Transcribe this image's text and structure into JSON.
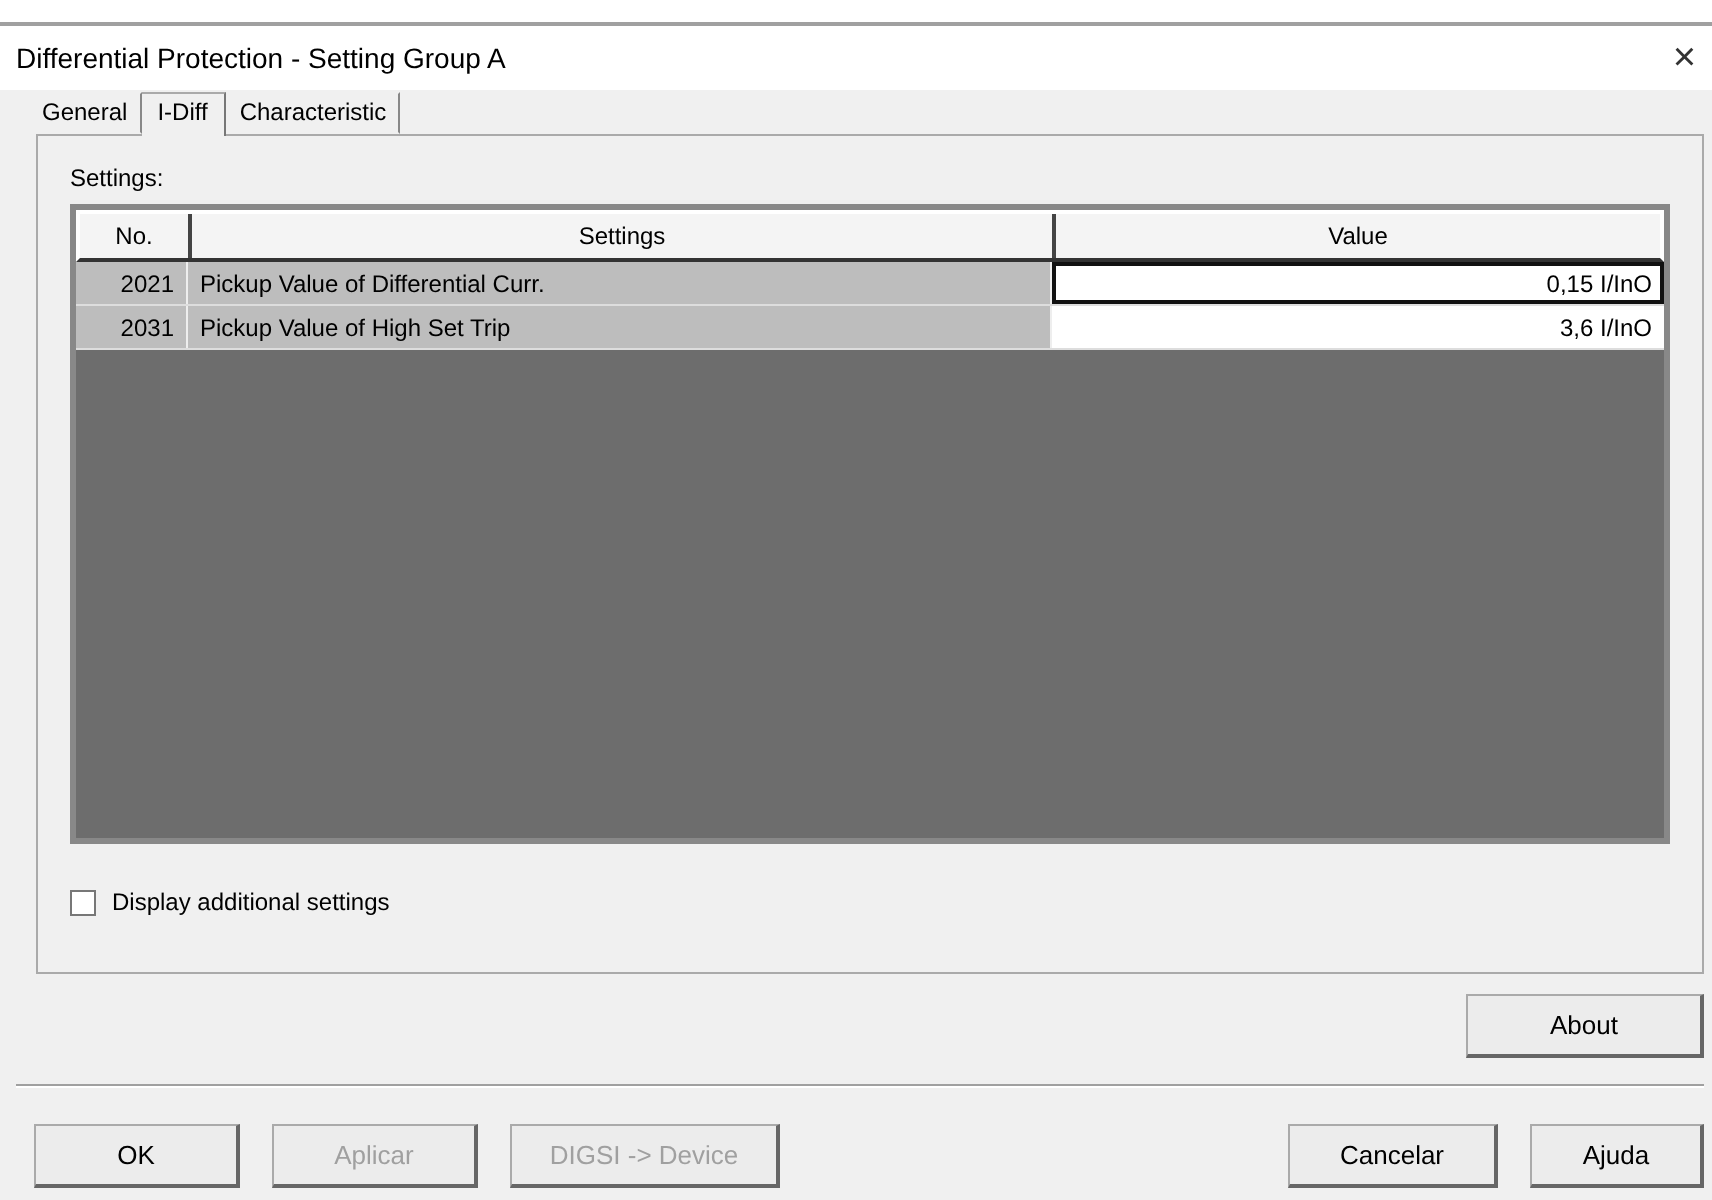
{
  "window": {
    "title": "Differential Protection - Setting Group A",
    "close": "×"
  },
  "tabs": [
    {
      "label": "General",
      "selected": false
    },
    {
      "label": "I-Diff",
      "selected": true
    },
    {
      "label": "Characteristic",
      "selected": false
    }
  ],
  "settings_label": "Settings:",
  "table": {
    "columns": [
      "No.",
      "Settings",
      "Value"
    ],
    "rows": [
      {
        "no": "2021",
        "setting": "Pickup Value of Differential Curr.",
        "value": "0,15 I/InO",
        "focused": true
      },
      {
        "no": "2031",
        "setting": "Pickup Value of High Set Trip",
        "value": "3,6 I/InO",
        "focused": false
      }
    ]
  },
  "additional": {
    "label": "Display additional settings",
    "checked": false
  },
  "about_button": {
    "label": "About",
    "disabled": false
  },
  "footer_left": [
    {
      "label": "OK",
      "disabled": false
    },
    {
      "label": "Aplicar",
      "disabled": true
    },
    {
      "label": "DIGSI -> Device",
      "disabled": true
    }
  ],
  "footer_right": [
    {
      "label": "Cancelar",
      "disabled": false
    },
    {
      "label": "Ajuda",
      "disabled": false
    }
  ]
}
